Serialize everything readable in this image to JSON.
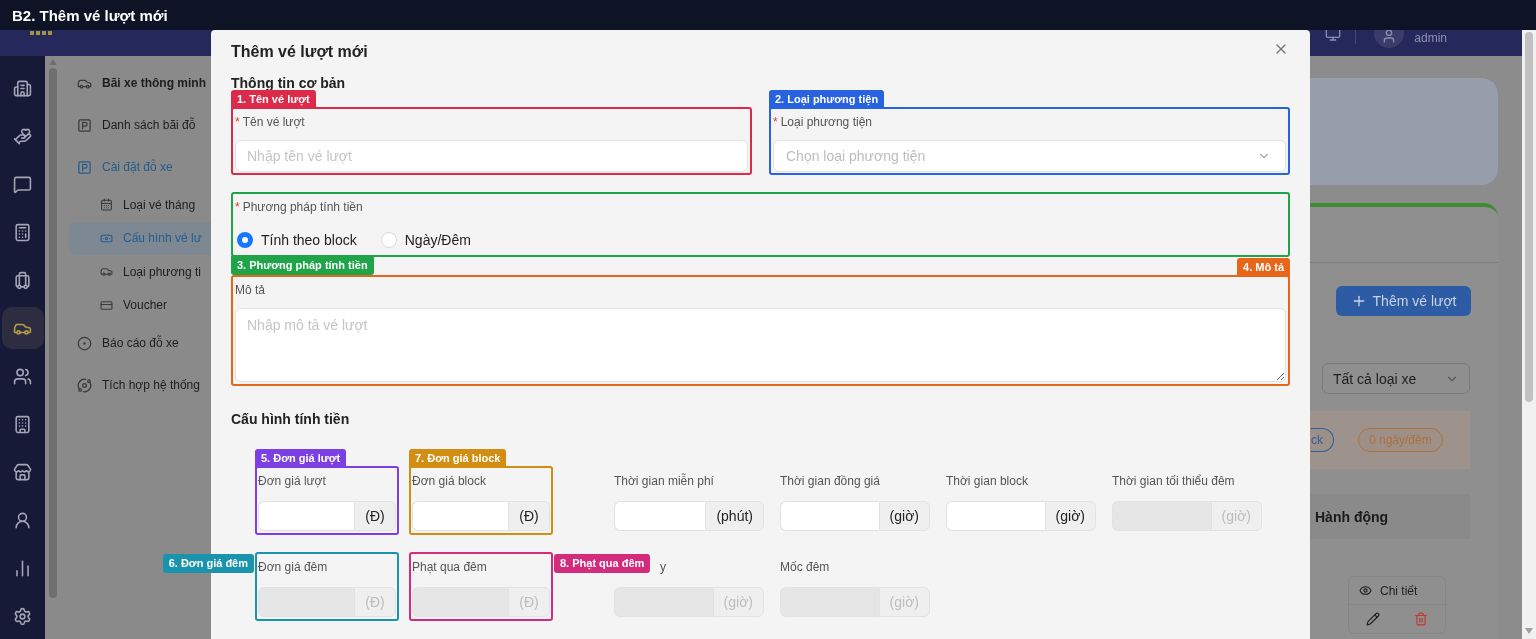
{
  "window": {
    "title": "B2. Thêm vé lượt mới"
  },
  "app_header": {
    "user": "admin"
  },
  "nav_rail": [
    {
      "selected": false
    },
    {
      "selected": false
    },
    {
      "selected": false
    },
    {
      "selected": false
    },
    {
      "selected": false
    },
    {
      "selected": true
    },
    {
      "selected": false
    },
    {
      "selected": false
    },
    {
      "selected": false
    },
    {
      "selected": false
    },
    {
      "selected": false
    },
    {
      "selected": false
    }
  ],
  "sidebar": {
    "items": [
      {
        "label": "Bãi xe thông minh",
        "kind": "heading",
        "selected": false
      },
      {
        "label": "Danh sách bãi đỗ",
        "kind": "link",
        "selected": false
      },
      {
        "label": "Cài đặt đỗ xe",
        "kind": "group",
        "selected": false,
        "expanded": true,
        "children": [
          {
            "label": "Loại vé tháng",
            "kind": "link",
            "selected": false
          },
          {
            "label": "Cấu hình vé lư",
            "kind": "link",
            "selected": true
          },
          {
            "label": "Loại phương ti",
            "kind": "link",
            "selected": false
          },
          {
            "label": "Voucher",
            "kind": "link",
            "selected": false
          }
        ]
      },
      {
        "label": "Báo cáo đỗ xe",
        "kind": "link",
        "selected": false
      },
      {
        "label": "Tích hợp hệ thống",
        "kind": "link",
        "selected": false
      }
    ]
  },
  "background_page": {
    "add_button": "Thêm vé lượt",
    "vehicle_filter": "Tất cả loại xe",
    "badges": [
      {
        "label": "ck",
        "color": "#2d5e9e"
      },
      {
        "label": "0 ngày/đêm",
        "color": "#b0703a"
      }
    ],
    "table": {
      "columns": [
        "Hành động"
      ],
      "row_action": "Chi tiết"
    }
  },
  "dialog": {
    "title": "Thêm vé lượt mới",
    "basic_section": {
      "heading": "Thông tin cơ bản",
      "name_field": {
        "label": "Tên vé lượt",
        "required_mark": "*",
        "placeholder": "Nhập tên vé lượt",
        "annotation": {
          "label": "1. Tên vé lượt",
          "color": "#dc2a4b",
          "kind": "above"
        }
      },
      "vehicle_field": {
        "label": "Loại phương tiện",
        "required_mark": "*",
        "placeholder": "Chọn loại phương tiện",
        "annotation": {
          "label": "2. Loại phương tiện",
          "color": "#2962e0",
          "kind": "above"
        }
      },
      "method_field": {
        "label": "Phương pháp tính tiền",
        "required_mark": "*",
        "options": [
          {
            "label": "Tính theo block",
            "selected": true
          },
          {
            "label": "Ngày/Đêm",
            "selected": false
          }
        ],
        "annotation": {
          "label": "3. Phương pháp tính tiền",
          "color": "#1fa44a",
          "kind": "below"
        }
      },
      "description_field": {
        "label": "Mô tả",
        "placeholder": "Nhập mô tả vé lượt",
        "annotation": {
          "label": "4. Mô tả",
          "color": "#e8661a",
          "kind": "corner"
        }
      }
    },
    "pricing_section": {
      "heading": "Cấu hình tính tiền",
      "rows": [
        [
          {
            "label": "Đơn giá lượt",
            "unit": "(Đ)",
            "disabled": false,
            "annotation": {
              "label": "5. Đơn giá lượt",
              "color": "#7b3fe4",
              "kind": "above"
            }
          },
          {
            "label": "Đơn giá block",
            "unit": "(Đ)",
            "disabled": false,
            "annotation": {
              "label": "7. Đơn giá block",
              "color": "#d18e12",
              "kind": "above"
            }
          },
          {
            "label": "Thời gian miễn phí",
            "unit": "(phút)",
            "disabled": false
          },
          {
            "label": "Thời gian đồng giá",
            "unit": "(giờ)",
            "disabled": false
          },
          {
            "label": "Thời gian block",
            "unit": "(giờ)",
            "disabled": false
          },
          {
            "label": "Thời gian tối thiểu đêm",
            "unit": "(giờ)",
            "disabled": true
          }
        ],
        [
          {
            "label": "Đơn giá đêm",
            "unit": "(Đ)",
            "disabled": true,
            "annotation": {
              "label": "6. Đơn giá đêm",
              "color": "#1a93ac",
              "kind": "left"
            }
          },
          {
            "label": "Phạt qua đêm",
            "unit": "(Đ)",
            "disabled": true,
            "annotation": {
              "label": "8. Phạt qua đêm",
              "color": "#d42c7c",
              "kind": "right"
            }
          },
          {
            "label": "y",
            "label_partial": true,
            "unit": "(giờ)",
            "disabled": true
          },
          {
            "label": "Mốc đêm",
            "unit": "(giờ)",
            "disabled": true
          }
        ]
      ]
    }
  }
}
